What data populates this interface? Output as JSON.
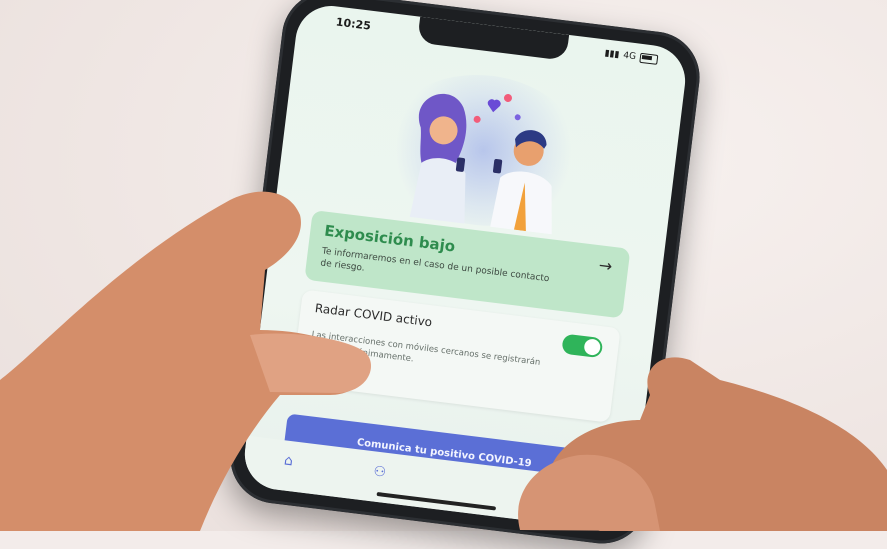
{
  "status_bar": {
    "time": "10:25",
    "network": "4G"
  },
  "exposure_card": {
    "title": "Exposición bajo",
    "description": "Te informaremos en el caso de un posible contacto de riesgo."
  },
  "radar_card": {
    "title": "Radar COVID activo",
    "description": "Las interacciones con móviles cercanos se registrarán siempre anónimamente.",
    "toggle_on": true
  },
  "report_button": {
    "label": "Comunica tu positivo COVID-19"
  },
  "bottom_nav": {
    "items": [
      "home-icon",
      "share-icon"
    ]
  },
  "colors": {
    "accent_green": "#2fb45a",
    "card_green": "#bfe6c9",
    "button_blue": "#5b6fd6"
  }
}
